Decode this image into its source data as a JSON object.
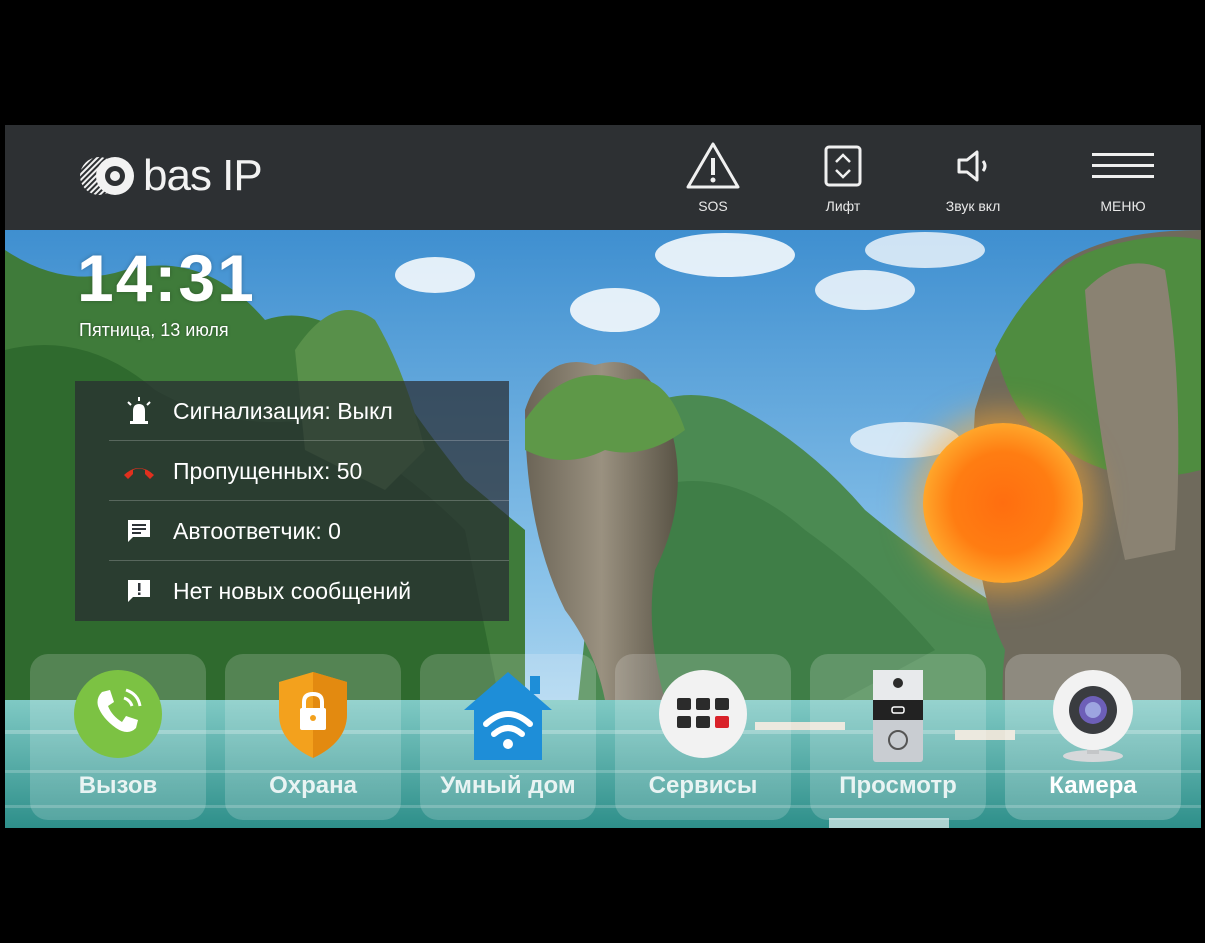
{
  "brand": {
    "logo_text": "bas IP"
  },
  "topbar": {
    "sos_label": "SOS",
    "lift_label": "Лифт",
    "sound_label": "Звук вкл",
    "menu_label": "МЕНЮ"
  },
  "home": {
    "time": "14:31",
    "date": "Пятница, 13 июля"
  },
  "status": {
    "alarm": "Сигнализация: Выкл",
    "missed": "Пропущенных: 50",
    "answering": "Автоответчик: 0",
    "messages": "Нет новых сообщений"
  },
  "dock": {
    "call": "Вызов",
    "security": "Охрана",
    "smart_home": "Умный дом",
    "services": "Сервисы",
    "monitor": "Просмотр",
    "camera": "Камера"
  },
  "colors": {
    "topbar": "#2d3033",
    "call_green": "#7cc243",
    "shield_orange": "#f3a11d",
    "smarthome_blue": "#1e8ed8",
    "missed_red": "#e0301e",
    "orb_orange": "#ff6e10"
  }
}
